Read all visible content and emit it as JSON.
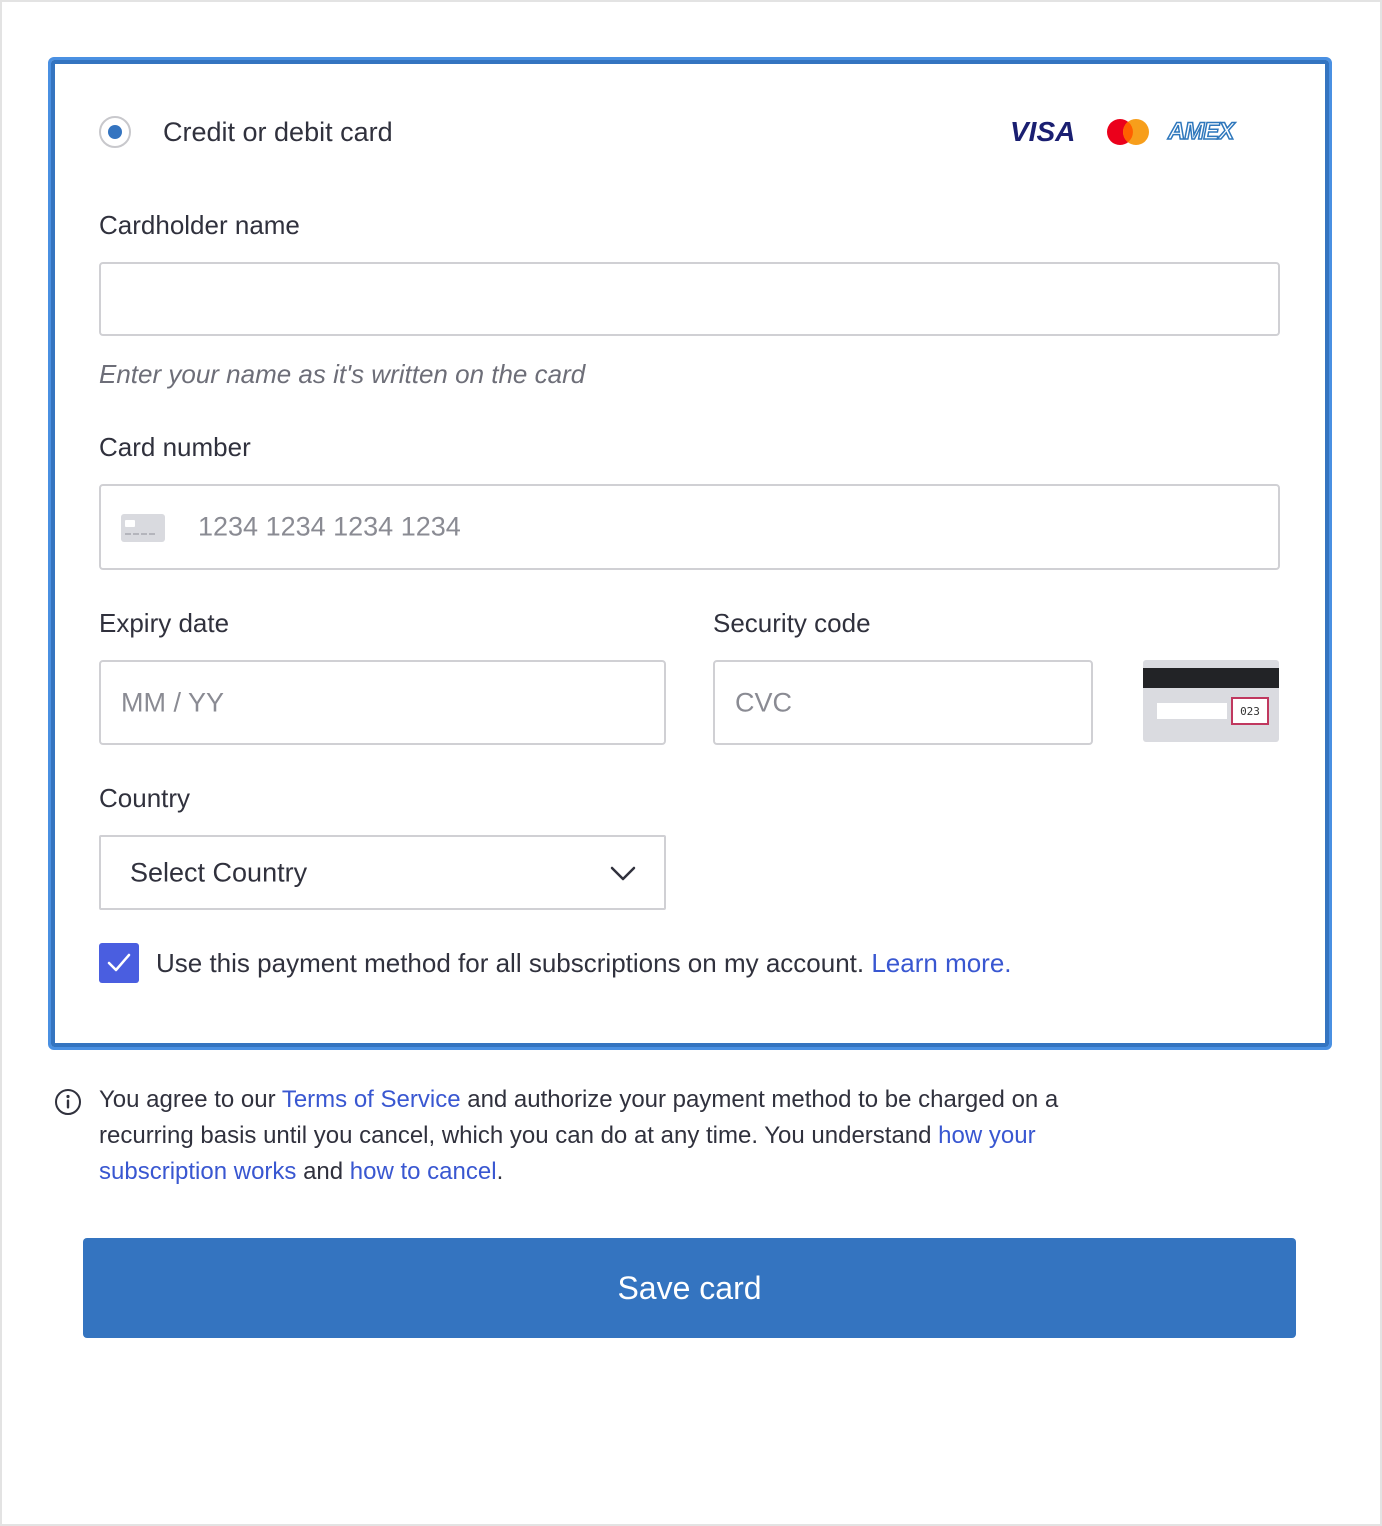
{
  "payment_method": {
    "label": "Credit or debit card",
    "selected": true,
    "brands": [
      "VISA",
      "mastercard",
      "AMEX"
    ],
    "brand_labels": {
      "visa": "VISA",
      "amex": "AMEX"
    }
  },
  "cardholder": {
    "label": "Cardholder name",
    "value": "",
    "hint": "Enter your name as it's written on the card"
  },
  "card_number": {
    "label": "Card number",
    "placeholder": "1234 1234 1234 1234",
    "icon": "credit-card-icon"
  },
  "expiry": {
    "label": "Expiry date",
    "placeholder": "MM / YY"
  },
  "security_code": {
    "label": "Security code",
    "placeholder": "CVC",
    "illustration_code": "023"
  },
  "country": {
    "label": "Country",
    "selected": "Select Country"
  },
  "subscription_checkbox": {
    "checked": true,
    "text": "Use this payment method for all subscriptions on my account.",
    "link": "Learn more."
  },
  "legal": {
    "part1": "You agree to our ",
    "terms_link": "Terms of Service",
    "part2": " and authorize your payment method to be charged on a recurring basis until you cancel, which you can do at any time. You understand ",
    "subscription_link": "how your subscription works",
    "part3": " and ",
    "cancel_link": "how to cancel",
    "part4": "."
  },
  "save_button": {
    "label": "Save card"
  },
  "colors": {
    "accent": "#3474c0",
    "checkbox": "#4a5ee0",
    "link": "#3957d1",
    "panel_border": "#4a90e2"
  }
}
